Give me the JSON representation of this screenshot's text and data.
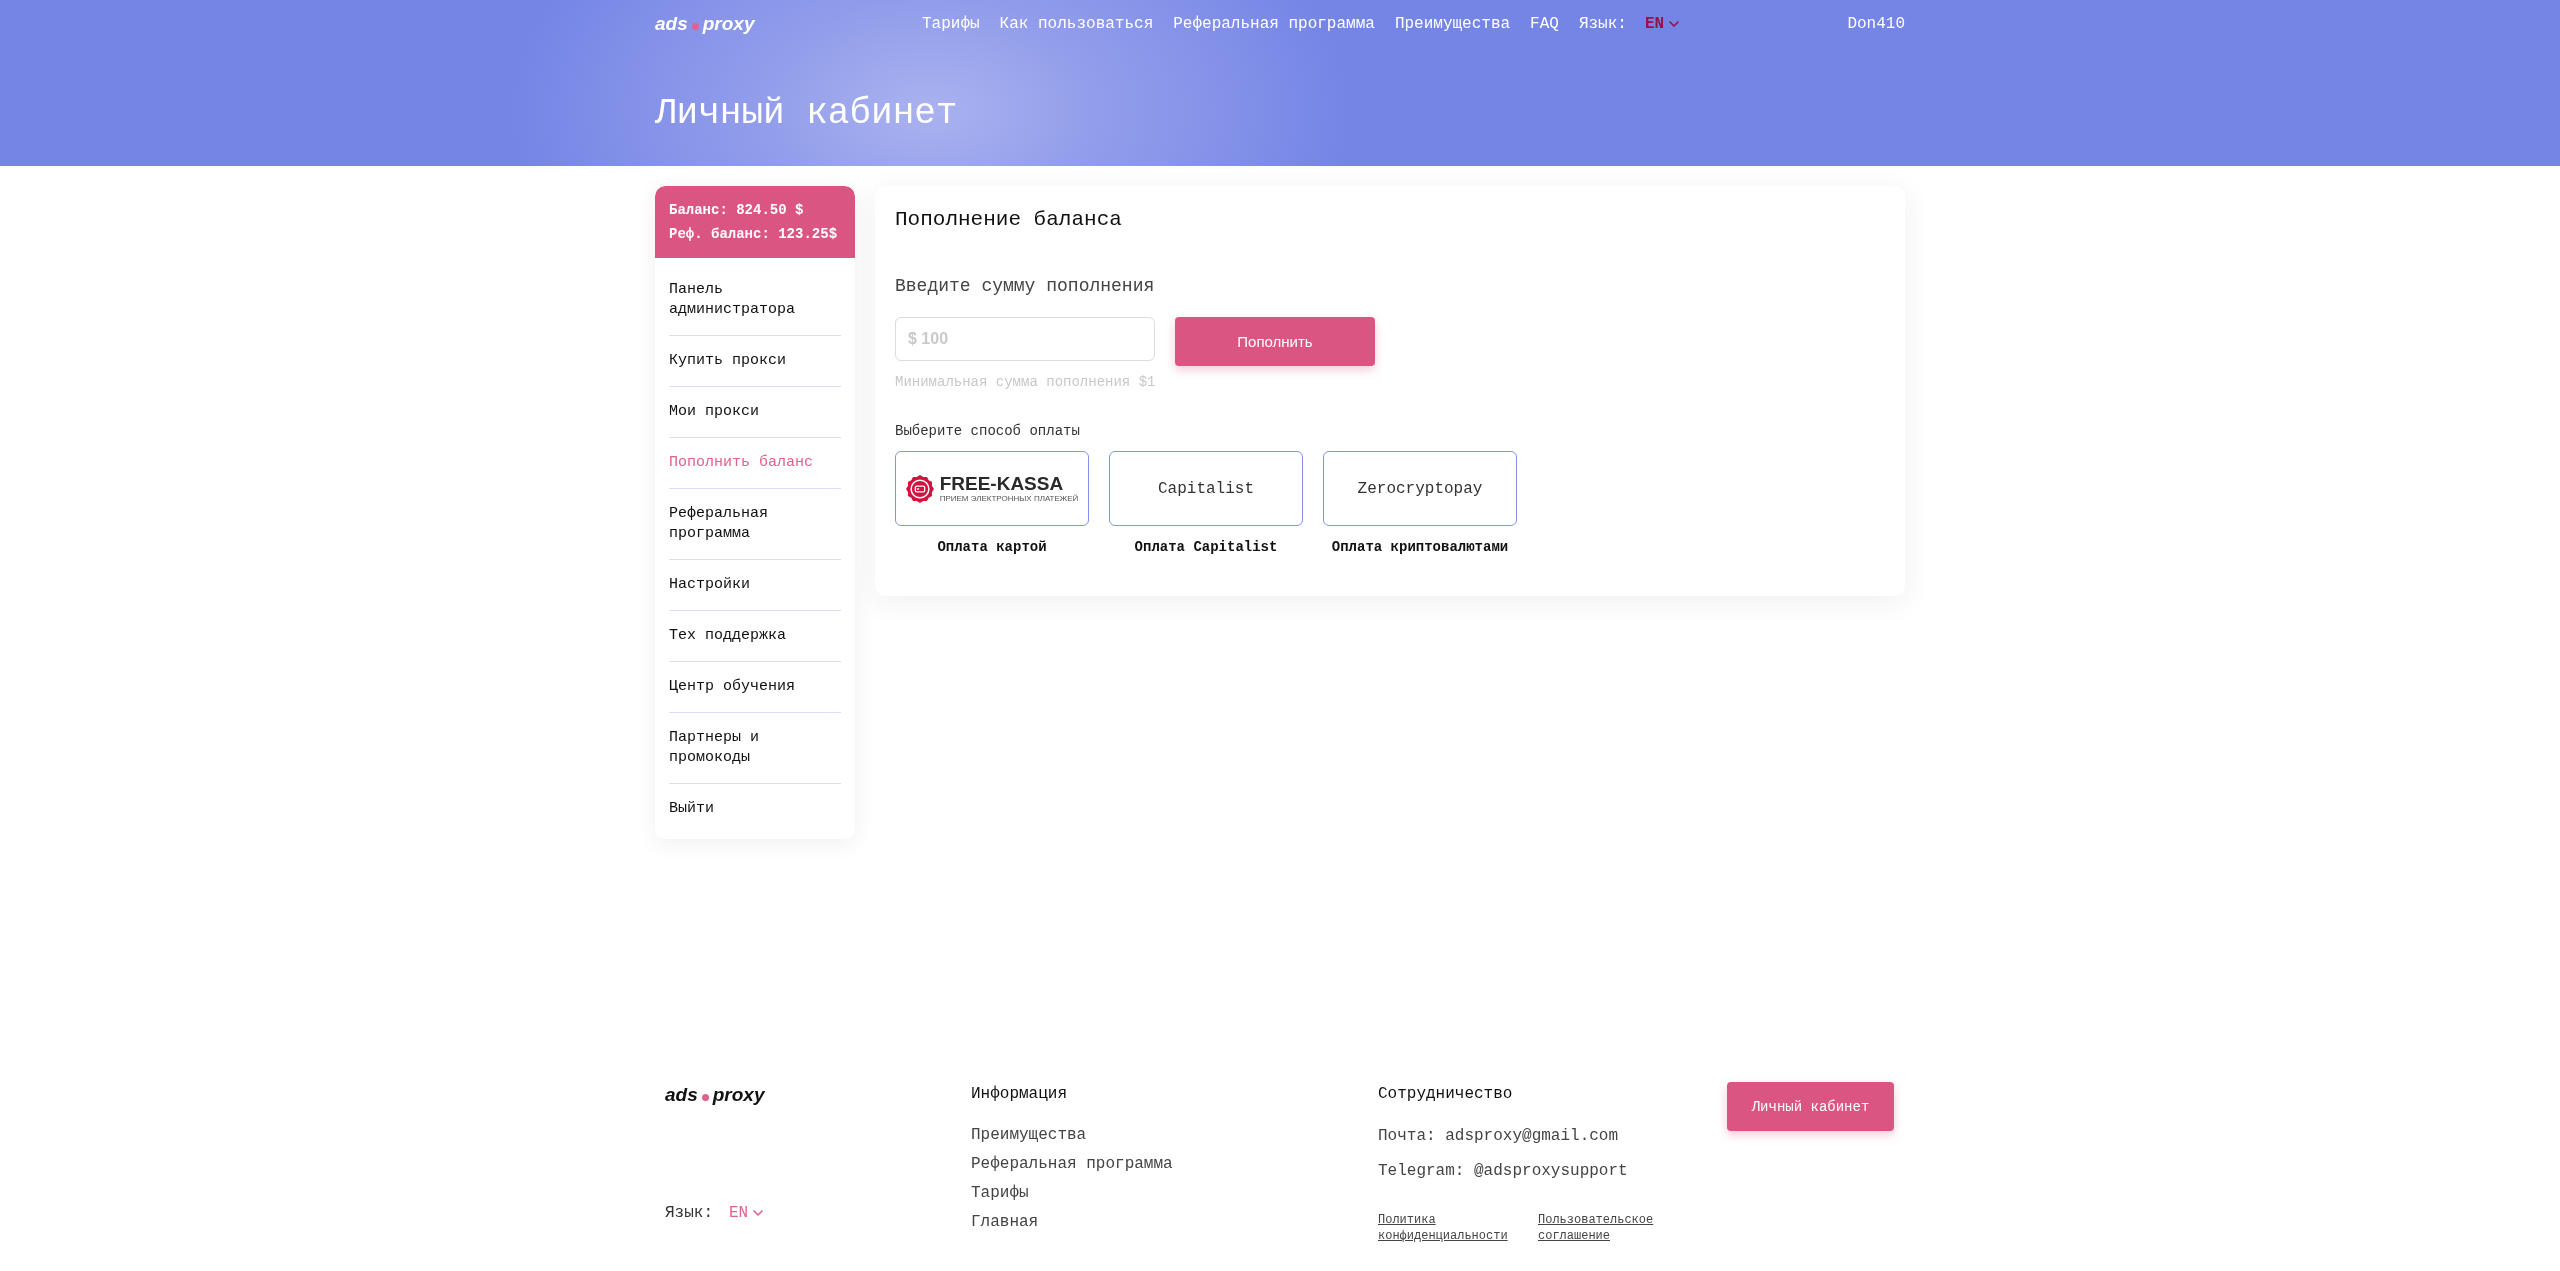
{
  "header": {
    "logo": {
      "left": "ads",
      "right": "proxy"
    },
    "nav": [
      "Тарифы",
      "Как пользоваться",
      "Реферальная программа",
      "Преимущества",
      "FAQ"
    ],
    "language": {
      "label": "Язык:",
      "value": "EN"
    },
    "user": "Don410",
    "title": "Личный кабинет"
  },
  "sidebar": {
    "balance": "Баланс: 824.50 $",
    "ref_balance": "Реф. баланс: 123.25$",
    "items": [
      {
        "label": "Панель администратора",
        "selected": false
      },
      {
        "label": "Купить прокси",
        "selected": false
      },
      {
        "label": "Мои прокси",
        "selected": false
      },
      {
        "label": "Пополнить баланс",
        "selected": true
      },
      {
        "label": "Реферальная программа",
        "selected": false
      },
      {
        "label": "Настройки",
        "selected": false
      },
      {
        "label": "Тех поддержка",
        "selected": false
      },
      {
        "label": "Центр обучения",
        "selected": false
      },
      {
        "label": "Партнеры и промокоды",
        "selected": false
      },
      {
        "label": "Выйти",
        "selected": false
      }
    ]
  },
  "topup": {
    "title": "Пополнение баланса",
    "amount_label": "Введите сумму пополнения",
    "amount_field": {
      "placeholder": "$ 100"
    },
    "submit": "Пополнить",
    "hint": "Минимальная сумма пополнения $1",
    "methods_label": "Выберите способ оплаты",
    "methods": [
      {
        "kind": "logo",
        "logo_text": "FREE-KASSA",
        "logo_subtext": "ПРИЕМ ЭЛЕКТРОННЫХ ПЛАТЕЖЕЙ",
        "caption": "Оплата картой"
      },
      {
        "kind": "text",
        "name": "Capitalist",
        "caption": "Оплата Capitalist"
      },
      {
        "kind": "text",
        "name": "Zerocryptopay",
        "caption": "Оплата криптовалютами"
      }
    ]
  },
  "footer": {
    "logo": {
      "left": "ads",
      "right": "proxy"
    },
    "language": {
      "label": "Язык:",
      "value": "EN"
    },
    "info": {
      "title": "Информация",
      "links": [
        "Преимущества",
        "Реферальная программа",
        "Тарифы",
        "Главная"
      ]
    },
    "cooperation": {
      "title": "Сотрудничество",
      "email": "Почта: adsproxy@gmail.com",
      "telegram": "Telegram: @adsproxysupport",
      "legal": [
        "Политика конфиденциальности",
        "Пользовательское соглашение"
      ]
    },
    "cabinet_button": "Личный кабинет"
  }
}
